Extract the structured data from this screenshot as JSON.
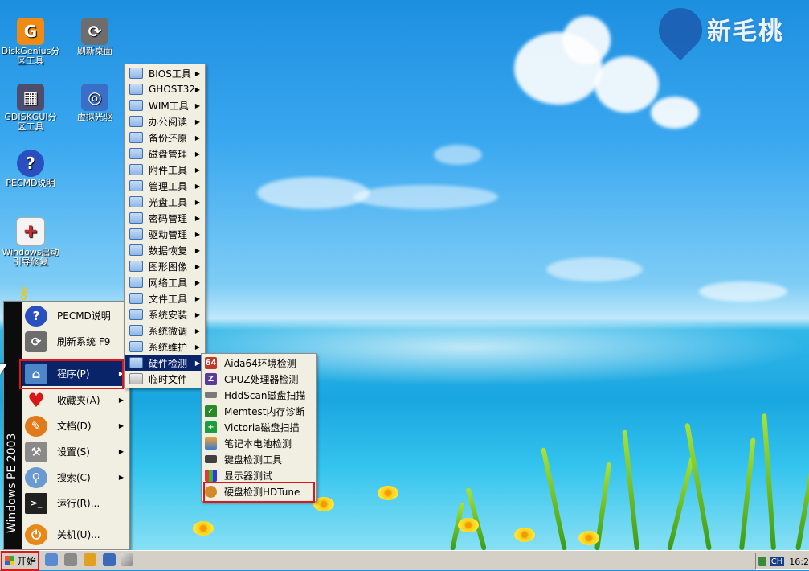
{
  "logo": {
    "text": "新毛桃"
  },
  "desktop_icons": [
    {
      "label": "DiskGenius分区工具",
      "icon": "diskgenius-icon",
      "color": "#f08a12"
    },
    {
      "label": "刷新桌面",
      "icon": "refresh-desktop-icon",
      "color": "#6d6d6d"
    },
    {
      "label": "GDISKGUI分区工具",
      "icon": "gdiskgui-icon",
      "color": "#4d4d6d"
    },
    {
      "label": "虚拟光驱",
      "icon": "virtual-drive-icon",
      "color": "#3a6fc8"
    },
    {
      "label": "PECMD说明",
      "icon": "help-icon",
      "color": "#2a50c0"
    },
    {
      "label": "Windows启动引导修复",
      "icon": "boot-repair-icon",
      "color": "#c03030"
    }
  ],
  "start_menu": {
    "side_text": "Windows PE 2003",
    "items": [
      {
        "label": "PECMD说明",
        "icon": "help-icon",
        "color": "#2a50c0",
        "arrow": false
      },
      {
        "label": "刷新系统 F9",
        "icon": "refresh-icon",
        "color": "#6d6d6d",
        "arrow": false
      },
      {
        "label": "程序(P)",
        "icon": "programs-folder-icon",
        "color": "#4d86c8",
        "arrow": true,
        "highlighted": true
      },
      {
        "label": "收藏夹(A)",
        "icon": "favorites-heart-icon",
        "color": "#d81818",
        "arrow": true
      },
      {
        "label": "文档(D)",
        "icon": "documents-icon",
        "color": "#e07a1a",
        "arrow": true
      },
      {
        "label": "设置(S)",
        "icon": "settings-tools-icon",
        "color": "#8a8a8a",
        "arrow": true
      },
      {
        "label": "搜索(C)",
        "icon": "search-icon",
        "color": "#6a9ad0",
        "arrow": true
      },
      {
        "label": "运行(R)...",
        "icon": "run-icon",
        "color": "#202020",
        "arrow": false
      },
      {
        "label": "关机(U)...",
        "icon": "shutdown-icon",
        "color": "#e8881a",
        "arrow": false
      }
    ]
  },
  "programs_menu": {
    "items": [
      {
        "label": "BIOS工具",
        "arrow": true
      },
      {
        "label": "GHOST32",
        "arrow": true
      },
      {
        "label": "WIM工具",
        "arrow": true
      },
      {
        "label": "办公阅读",
        "arrow": true
      },
      {
        "label": "备份还原",
        "arrow": true
      },
      {
        "label": "磁盘管理",
        "arrow": true
      },
      {
        "label": "附件工具",
        "arrow": true
      },
      {
        "label": "管理工具",
        "arrow": true
      },
      {
        "label": "光盘工具",
        "arrow": true
      },
      {
        "label": "密码管理",
        "arrow": true
      },
      {
        "label": "驱动管理",
        "arrow": true
      },
      {
        "label": "数据恢复",
        "arrow": true
      },
      {
        "label": "图形图像",
        "arrow": true
      },
      {
        "label": "网络工具",
        "arrow": true
      },
      {
        "label": "文件工具",
        "arrow": true
      },
      {
        "label": "系统安装",
        "arrow": true
      },
      {
        "label": "系统微调",
        "arrow": true
      },
      {
        "label": "系统维护",
        "arrow": true
      },
      {
        "label": "硬件检测",
        "arrow": true,
        "highlighted": true
      },
      {
        "label": "临时文件",
        "arrow": false
      }
    ]
  },
  "hardware_menu": {
    "items": [
      {
        "label": "Aida64环境检测",
        "icon": "aida64-icon",
        "icon_text": "64",
        "color": "#c0392b"
      },
      {
        "label": "CPUZ处理器检测",
        "icon": "cpuz-icon",
        "icon_text": "Z",
        "color": "#5a3a9a"
      },
      {
        "label": "HddScan磁盘扫描",
        "icon": "hddscan-icon",
        "icon_text": "",
        "color": "#7a7a7a"
      },
      {
        "label": "Memtest内存诊断",
        "icon": "memtest-icon",
        "icon_text": "✓",
        "color": "#2a8a2a"
      },
      {
        "label": "Victoria磁盘扫描",
        "icon": "victoria-icon",
        "icon_text": "+",
        "color": "#1aa03a"
      },
      {
        "label": "笔记本电池检测",
        "icon": "battery-icon",
        "icon_text": "",
        "color": "#d0602a"
      },
      {
        "label": "键盘检测工具",
        "icon": "keyboard-icon",
        "icon_text": "",
        "color": "#404040"
      },
      {
        "label": "显示器测试",
        "icon": "monitor-test-icon",
        "icon_text": "",
        "color": "#3a7a3a"
      },
      {
        "label": "硬盘检测HDTune",
        "icon": "hdtune-icon",
        "icon_text": "",
        "color": "#d08a2a"
      }
    ]
  },
  "taskbar": {
    "start_label": "开始",
    "tray_lang": "CH",
    "clock": "16:2"
  }
}
